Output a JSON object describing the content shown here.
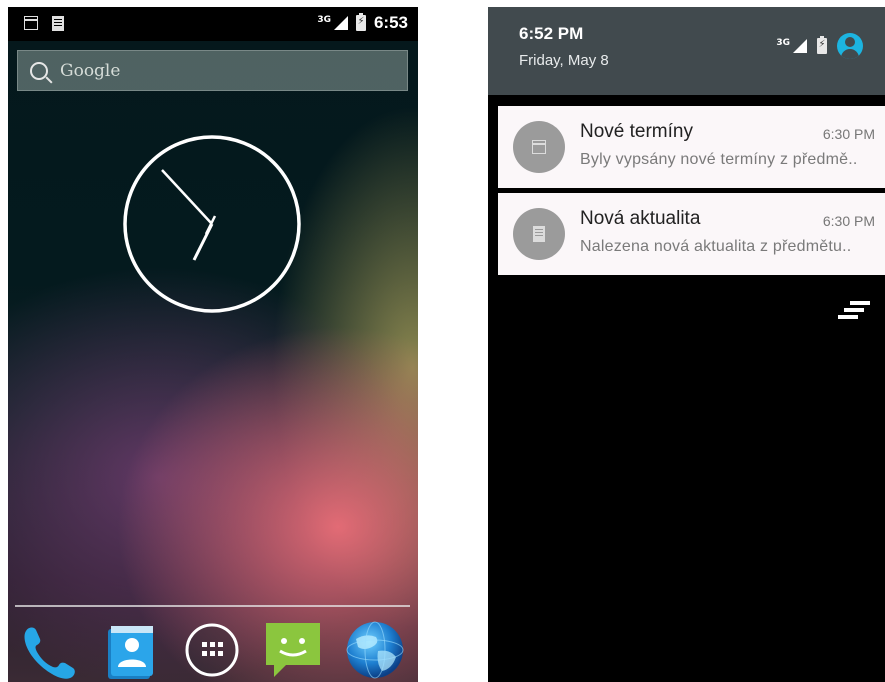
{
  "home": {
    "status_bar": {
      "network_type": "3G",
      "time": "6:53",
      "icons": [
        "calendar-icon",
        "document-icon",
        "signal-icon",
        "battery-charging-icon"
      ]
    },
    "search": {
      "label": "Google"
    },
    "dock": {
      "apps": [
        {
          "name": "phone",
          "icon": "phone-icon"
        },
        {
          "name": "contacts",
          "icon": "contacts-icon"
        },
        {
          "name": "all-apps",
          "icon": "app-drawer-icon"
        },
        {
          "name": "messaging",
          "icon": "messaging-icon"
        },
        {
          "name": "browser",
          "icon": "browser-globe-icon"
        }
      ]
    }
  },
  "shade": {
    "header": {
      "time": "6:52 PM",
      "date": "Friday, May 8",
      "network_type": "3G",
      "icons": [
        "signal-icon",
        "battery-charging-icon",
        "account-icon"
      ],
      "accent_color": "#1cb4e0"
    },
    "notifications": [
      {
        "title": "Nové termíny",
        "time": "6:30 PM",
        "text": "Byly vypsány nové termíny z předmě..",
        "icon": "calendar-icon"
      },
      {
        "title": "Nová aktualita",
        "time": "6:30 PM",
        "text": "Nalezena nová aktualita z předmětu..",
        "icon": "document-icon"
      }
    ]
  }
}
